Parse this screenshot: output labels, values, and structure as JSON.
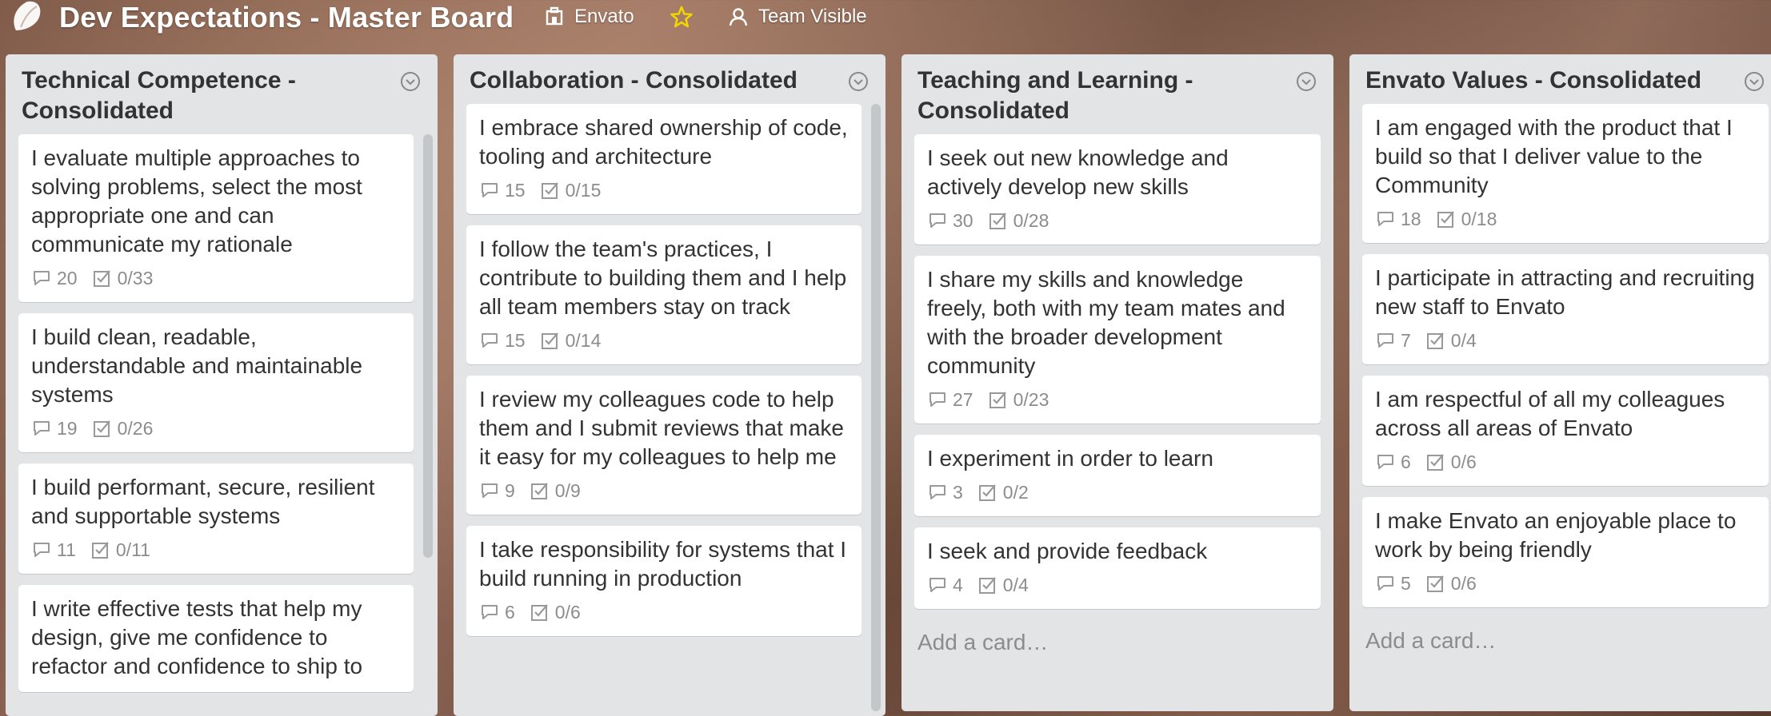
{
  "header": {
    "title": "Dev Expectations - Master Board",
    "org_label": "Envato",
    "visibility_label": "Team Visible",
    "icons": {
      "logo": "trello-leaf-icon",
      "org": "organization-icon",
      "star": "star-icon",
      "visibility": "team-visibility-icon"
    }
  },
  "colors": {
    "star": "#f2d600",
    "list_bg": "#e2e4e6",
    "card_bg": "#ffffff",
    "muted_text": "#8c8c8c"
  },
  "lists": [
    {
      "title": "Technical Competence - Consolidated",
      "cards": [
        {
          "text": "I evaluate multiple approaches to solving problems, select the most appropriate one and can communicate my rationale",
          "comments": "20",
          "checklist": "0/33"
        },
        {
          "text": "I build clean, readable, understandable and maintainable systems",
          "comments": "19",
          "checklist": "0/26"
        },
        {
          "text": "I build performant, secure, resilient and supportable systems",
          "comments": "11",
          "checklist": "0/11"
        },
        {
          "text": "I write effective tests that help my design, give me confidence to refactor and confidence to ship to",
          "comments": "",
          "checklist": ""
        }
      ]
    },
    {
      "title": "Collaboration - Consolidated",
      "cards": [
        {
          "text": "I embrace shared ownership of code, tooling and architecture",
          "comments": "15",
          "checklist": "0/15"
        },
        {
          "text": "I follow the team's practices, I contribute to building them and I help all team members stay on track",
          "comments": "15",
          "checklist": "0/14"
        },
        {
          "text": "I review my colleagues code to help them and I submit reviews that make it easy for my colleagues to help me",
          "comments": "9",
          "checklist": "0/9"
        },
        {
          "text": "I take responsibility for systems that I build running in production",
          "comments": "6",
          "checklist": "0/6"
        }
      ]
    },
    {
      "title": "Teaching and Learning - Consolidated",
      "cards": [
        {
          "text": "I seek out new knowledge and actively develop new skills",
          "comments": "30",
          "checklist": "0/28"
        },
        {
          "text": "I share my skills and knowledge freely, both with my team mates and with the broader development community",
          "comments": "27",
          "checklist": "0/23"
        },
        {
          "text": "I experiment in order to learn",
          "comments": "3",
          "checklist": "0/2"
        },
        {
          "text": "I seek and provide feedback",
          "comments": "4",
          "checklist": "0/4"
        }
      ],
      "add_card": "Add a card…"
    },
    {
      "title": "Envato Values - Consolidated",
      "cards": [
        {
          "text": "I am engaged with the product that I build so that I deliver value to the Community",
          "comments": "18",
          "checklist": "0/18"
        },
        {
          "text": "I participate in attracting and recruiting new staff to Envato",
          "comments": "7",
          "checklist": "0/4"
        },
        {
          "text": "I am respectful of all my colleagues across all areas of Envato",
          "comments": "6",
          "checklist": "0/6"
        },
        {
          "text": "I make Envato an enjoyable place to work by being friendly",
          "comments": "5",
          "checklist": "0/6"
        }
      ],
      "add_card": "Add a card…"
    }
  ]
}
